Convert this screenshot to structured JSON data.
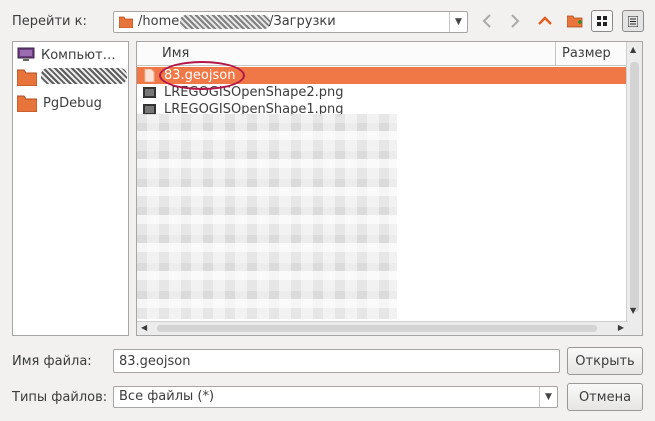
{
  "header": {
    "goto_label": "Перейти к:",
    "path_prefix": "/home",
    "path_suffix": "/Загрузки"
  },
  "toolbar": {
    "back_icon": "chevron-left-icon",
    "forward_icon": "chevron-right-icon",
    "up_icon": "chevron-up-icon",
    "new_folder_icon": "new-folder-icon",
    "icon_view_icon": "grid-view-icon",
    "detail_view_icon": "list-view-icon"
  },
  "sidebar": {
    "items": [
      {
        "label": "Компьют…",
        "icon": "computer-icon"
      },
      {
        "label": "",
        "icon": "folder-icon"
      },
      {
        "label": "PgDebug",
        "icon": "folder-icon"
      }
    ]
  },
  "filelist": {
    "columns": {
      "name": "Имя",
      "size": "Размер"
    },
    "rows": [
      {
        "name": "83.geojson",
        "icon": "document-icon",
        "selected": true
      },
      {
        "name": "LREGOGISOpenShape2.png",
        "icon": "image-file-icon"
      },
      {
        "name": "LREGOGISOpenShape1.png",
        "icon": "image-file-icon"
      }
    ]
  },
  "footer": {
    "filename_label": "Имя файла:",
    "filename_value": "83.geojson",
    "open_button": "Открыть",
    "filetype_label": "Типы файлов:",
    "filetype_value": "Все файлы (*)",
    "cancel_button": "Отмена"
  },
  "colors": {
    "selection": "#f07746",
    "accent_up": "#e25d20",
    "annotation_circle": "#b3174a"
  }
}
